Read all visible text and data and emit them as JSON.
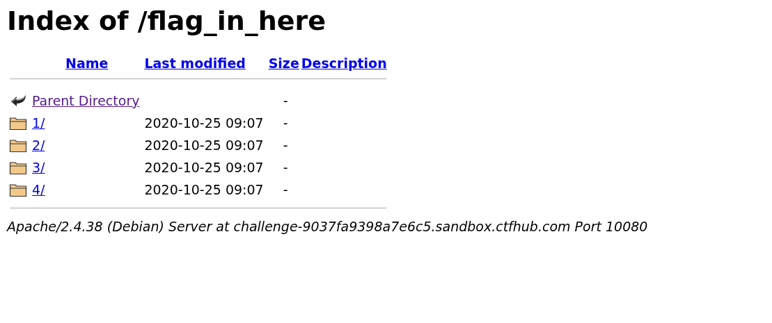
{
  "title": "Index of /flag_in_here",
  "columns": [
    {
      "label": "Name"
    },
    {
      "label": "Last modified"
    },
    {
      "label": "Size"
    },
    {
      "label": "Description"
    }
  ],
  "rows": [
    {
      "kind": "parent",
      "name": "Parent Directory",
      "visited": true,
      "modified": "",
      "size": "-"
    },
    {
      "kind": "folder",
      "name": "1/",
      "visited": false,
      "modified": "2020-10-25 09:07",
      "size": "-"
    },
    {
      "kind": "folder",
      "name": "2/",
      "visited": false,
      "modified": "2020-10-25 09:07",
      "size": "-"
    },
    {
      "kind": "folder",
      "name": "3/",
      "visited": false,
      "modified": "2020-10-25 09:07",
      "size": "-"
    },
    {
      "kind": "folder",
      "name": "4/",
      "visited": false,
      "modified": "2020-10-25 09:07",
      "size": "-"
    }
  ],
  "footer": "Apache/2.4.38 (Debian) Server at challenge-9037fa9398a7e6c5.sandbox.ctfhub.com Port 10080"
}
